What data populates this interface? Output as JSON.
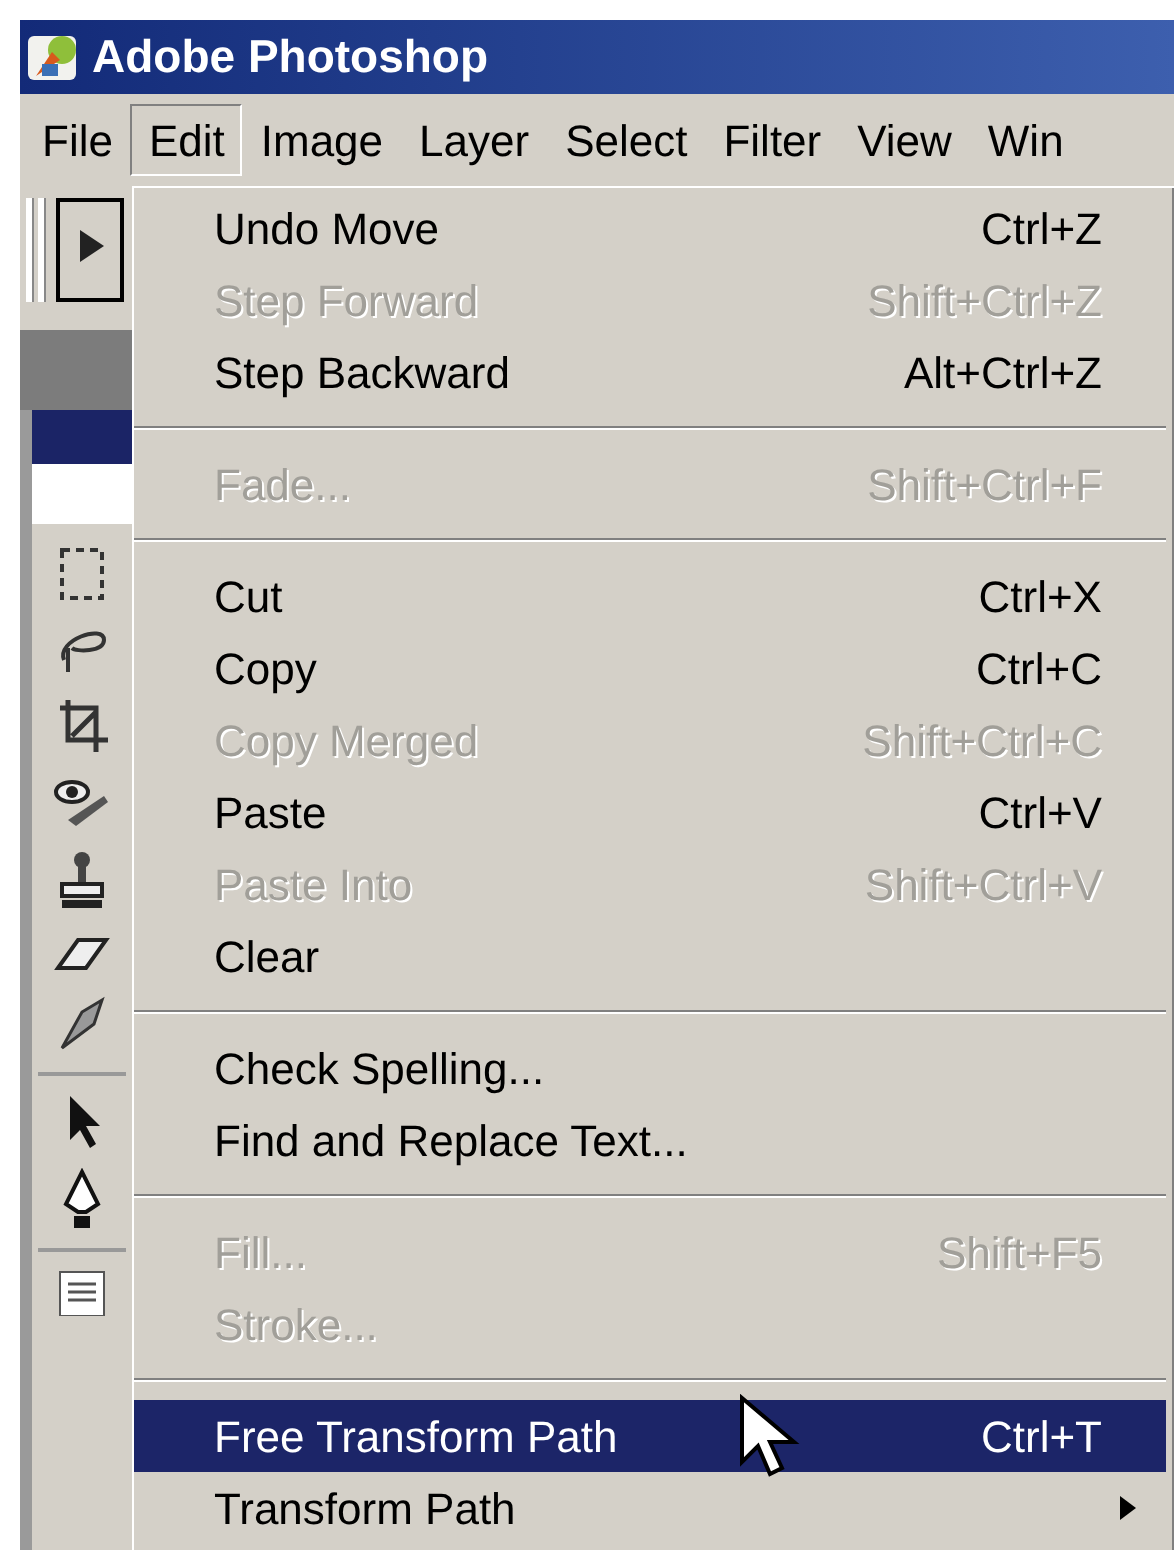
{
  "window": {
    "title": "Adobe Photoshop"
  },
  "menubar": [
    {
      "label": "File",
      "selected": false
    },
    {
      "label": "Edit",
      "selected": true
    },
    {
      "label": "Image",
      "selected": false
    },
    {
      "label": "Layer",
      "selected": false
    },
    {
      "label": "Select",
      "selected": false
    },
    {
      "label": "Filter",
      "selected": false
    },
    {
      "label": "View",
      "selected": false
    },
    {
      "label": "Win",
      "selected": false
    }
  ],
  "menu": [
    {
      "kind": "item",
      "label": "Undo Move",
      "shortcut": "Ctrl+Z",
      "disabled": false,
      "selected": false
    },
    {
      "kind": "item",
      "label": "Step Forward",
      "shortcut": "Shift+Ctrl+Z",
      "disabled": true,
      "selected": false
    },
    {
      "kind": "item",
      "label": "Step Backward",
      "shortcut": "Alt+Ctrl+Z",
      "disabled": false,
      "selected": false
    },
    {
      "kind": "separator"
    },
    {
      "kind": "item",
      "label": "Fade...",
      "shortcut": "Shift+Ctrl+F",
      "disabled": true,
      "selected": false
    },
    {
      "kind": "separator"
    },
    {
      "kind": "item",
      "label": "Cut",
      "shortcut": "Ctrl+X",
      "disabled": false,
      "selected": false
    },
    {
      "kind": "item",
      "label": "Copy",
      "shortcut": "Ctrl+C",
      "disabled": false,
      "selected": false
    },
    {
      "kind": "item",
      "label": "Copy Merged",
      "shortcut": "Shift+Ctrl+C",
      "disabled": true,
      "selected": false
    },
    {
      "kind": "item",
      "label": "Paste",
      "shortcut": "Ctrl+V",
      "disabled": false,
      "selected": false
    },
    {
      "kind": "item",
      "label": "Paste Into",
      "shortcut": "Shift+Ctrl+V",
      "disabled": true,
      "selected": false
    },
    {
      "kind": "item",
      "label": "Clear",
      "disabled": false,
      "selected": false
    },
    {
      "kind": "separator"
    },
    {
      "kind": "item",
      "label": "Check Spelling...",
      "disabled": false,
      "selected": false
    },
    {
      "kind": "item",
      "label": "Find and Replace Text...",
      "disabled": false,
      "selected": false
    },
    {
      "kind": "separator"
    },
    {
      "kind": "item",
      "label": "Fill...",
      "shortcut": "Shift+F5",
      "disabled": true,
      "selected": false
    },
    {
      "kind": "item",
      "label": "Stroke...",
      "disabled": true,
      "selected": false
    },
    {
      "kind": "separator"
    },
    {
      "kind": "item",
      "label": "Free Transform Path",
      "shortcut": "Ctrl+T",
      "disabled": false,
      "selected": true
    },
    {
      "kind": "item",
      "label": "Transform Path",
      "disabled": false,
      "selected": false,
      "submenu": true
    }
  ]
}
